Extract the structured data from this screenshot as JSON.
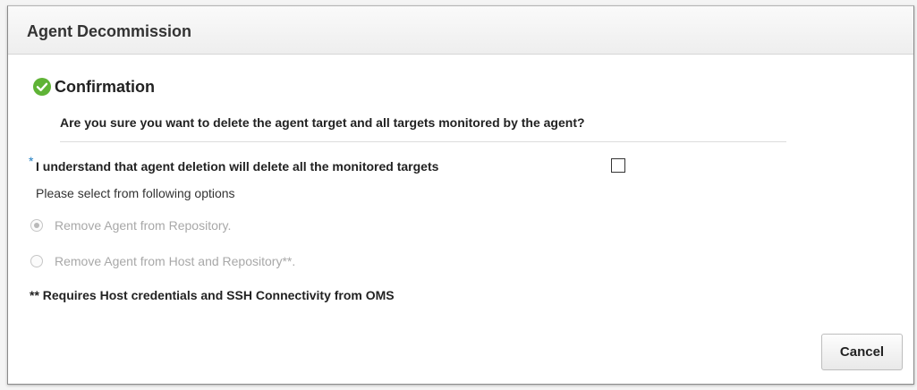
{
  "dialog": {
    "title": "Agent Decommission"
  },
  "confirmation": {
    "icon": "check-circle-icon",
    "icon_color": "#5fb336",
    "title": "Confirmation",
    "question": "Are you sure you want to delete the agent target and all targets monitored by the agent?"
  },
  "acknowledge": {
    "required_marker": "*",
    "label": "I understand that agent deletion will delete all the monitored targets",
    "checked": false
  },
  "options": {
    "prompt": "Please select from following options",
    "radios": [
      {
        "label": "Remove Agent from Repository.",
        "selected": true,
        "disabled": true
      },
      {
        "label": "Remove Agent from Host and Repository**.",
        "selected": false,
        "disabled": true
      }
    ]
  },
  "note": "** Requires Host credentials and SSH Connectivity from OMS",
  "buttons": {
    "cancel_label": "Cancel"
  },
  "colors": {
    "required_marker": "#1f7ec2",
    "disabled_text": "#a8a8a8"
  }
}
